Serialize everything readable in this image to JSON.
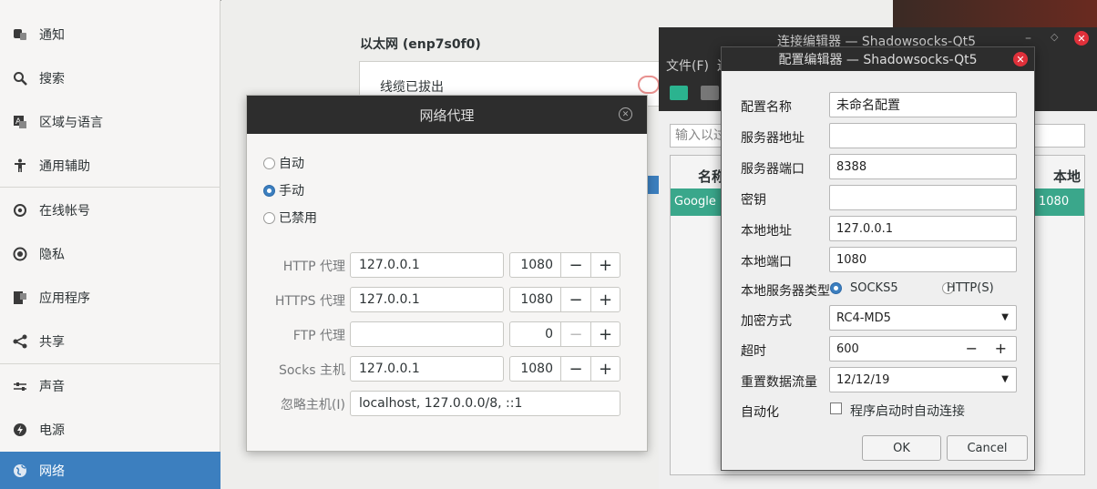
{
  "sidebar": {
    "items": [
      {
        "label": "通知",
        "icon": "notification-icon"
      },
      {
        "label": "搜索",
        "icon": "search-icon"
      },
      {
        "label": "区域与语言",
        "icon": "region-language-icon"
      },
      {
        "label": "通用辅助",
        "icon": "accessibility-icon"
      },
      {
        "label": "在线帐号",
        "icon": "online-accounts-icon"
      },
      {
        "label": "隐私",
        "icon": "privacy-icon"
      },
      {
        "label": "应用程序",
        "icon": "applications-icon"
      },
      {
        "label": "共享",
        "icon": "share-icon"
      },
      {
        "label": "声音",
        "icon": "sound-icon"
      },
      {
        "label": "电源",
        "icon": "power-icon"
      },
      {
        "label": "网络",
        "icon": "network-icon"
      }
    ],
    "active_index": 10
  },
  "network": {
    "ethernet_title": "以太网 (enp7s0f0)",
    "cable_status": "线缆已拔出"
  },
  "proxy_dialog": {
    "title": "网络代理",
    "modes": [
      {
        "label": "自动",
        "selected": false
      },
      {
        "label": "手动",
        "selected": true
      },
      {
        "label": "已禁用",
        "selected": false
      }
    ],
    "rows": [
      {
        "label": "HTTP 代理",
        "host": "127.0.0.1",
        "port": "1080"
      },
      {
        "label": "HTTPS 代理",
        "host": "127.0.0.1",
        "port": "1080"
      },
      {
        "label": "FTP 代理",
        "host": "",
        "port": "0"
      },
      {
        "label": "Socks 主机",
        "host": "127.0.0.1",
        "port": "1080"
      }
    ],
    "ignore_label": "忽略主机(I)",
    "ignore_value": "localhost, 127.0.0.0/8, ::1"
  },
  "conn_editor": {
    "title": "连接编辑器 — Shadowsocks-Qt5",
    "menu_file": "文件(F)",
    "menu_next": "连",
    "filter_placeholder": "输入以过",
    "col_name": "名称",
    "col_local": "本地",
    "row_name": "Google",
    "row_port": "1080"
  },
  "config_editor": {
    "title": "配置编辑器 — Shadowsocks-Qt5",
    "name_label": "配置名称",
    "name_value": "未命名配置",
    "server_label": "服务器地址",
    "server_value": "",
    "port_label": "服务器端口",
    "port_value": "8388",
    "password_label": "密钥",
    "password_value": "",
    "local_addr_label": "本地地址",
    "local_addr_value": "127.0.0.1",
    "local_port_label": "本地端口",
    "local_port_value": "1080",
    "server_type_label": "本地服务器类型",
    "type_socks5": "SOCKS5",
    "type_http": "HTTP(S)",
    "method_label": "加密方式",
    "method_value": "RC4-MD5",
    "timeout_label": "超时",
    "timeout_value": "600",
    "reset_label": "重置数据流量",
    "reset_value": "12/12/19",
    "auto_label": "自动化",
    "auto_checkbox": "程序启动时自动连接",
    "ok": "OK",
    "cancel": "Cancel"
  },
  "colors": {
    "accent": "#3c7fbf",
    "teal": "#3aa78b",
    "titlebar": "#2d2d2d",
    "close_red": "#e0303a"
  }
}
